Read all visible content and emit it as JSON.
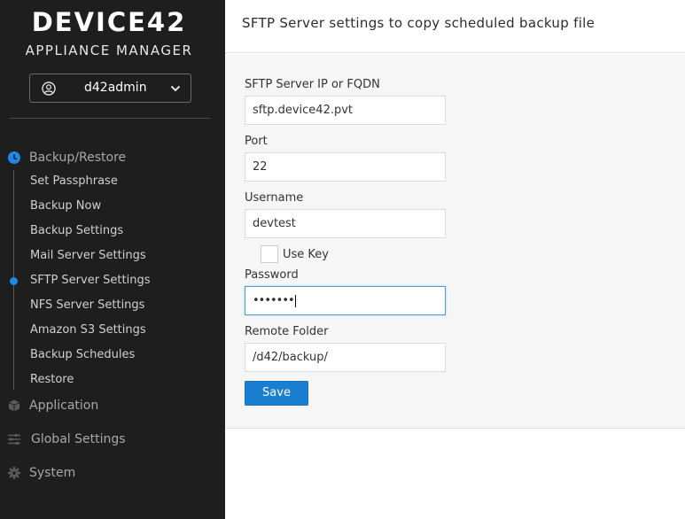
{
  "sidebar": {
    "logo": "DEVICE42",
    "subtitle": "APPLIANCE MANAGER",
    "user": "d42admin",
    "sections": {
      "backup_restore": "Backup/Restore",
      "application": "Application",
      "global_settings": "Global Settings",
      "system": "System"
    },
    "items": [
      "Set Passphrase",
      "Backup Now",
      "Backup Settings",
      "Mail Server Settings",
      "SFTP Server Settings",
      "NFS Server Settings",
      "Amazon S3 Settings",
      "Backup Schedules",
      "Restore"
    ],
    "active_item": "SFTP Server Settings"
  },
  "header": {
    "title": "SFTP Server settings to copy scheduled backup file"
  },
  "form": {
    "server_label": "SFTP Server IP or FQDN",
    "server_value": "sftp.device42.pvt",
    "port_label": "Port",
    "port_value": "22",
    "username_label": "Username",
    "username_value": "devtest",
    "use_key_label": "Use Key",
    "use_key_checked": false,
    "password_label": "Password",
    "password_value": "•••••••",
    "folder_label": "Remote Folder",
    "folder_value": "/d42/backup/",
    "save_label": "Save"
  },
  "colors": {
    "sidebar_bg": "#1e1e1e",
    "accent": "#1a7fd1",
    "active_dot": "#1e88e5",
    "panel_bg": "#f6f6f6"
  },
  "icons": {
    "user": "user-circle-icon",
    "chevron": "chevron-down-icon",
    "backup": "clock-icon",
    "application": "cube-icon",
    "global_settings": "sliders-icon",
    "system": "gear-icon"
  }
}
